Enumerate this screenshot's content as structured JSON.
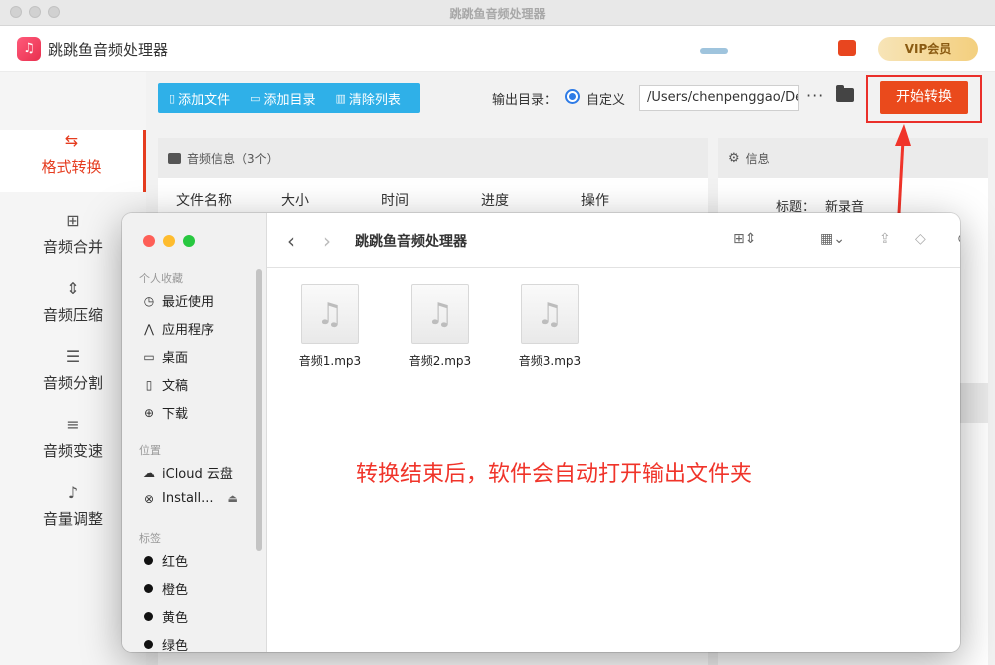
{
  "window": {
    "title": "跳跳鱼音频处理器"
  },
  "app": {
    "name": "跳跳鱼音频处理器",
    "logo_glyph": "♫",
    "promo_text": "VIP会员"
  },
  "sidebar": {
    "items": [
      {
        "label": "格式转换",
        "icon": "⇆"
      },
      {
        "label": "音频合并",
        "icon": "⊞"
      },
      {
        "label": "音频压缩",
        "icon": "⇕"
      },
      {
        "label": "音频分割",
        "icon": "☰"
      },
      {
        "label": "音频变速",
        "icon": "≡"
      },
      {
        "label": "音量调整",
        "icon": "♪"
      }
    ],
    "active_index": 0
  },
  "toolbar": {
    "add_file": "添加文件",
    "add_folder": "添加目录",
    "clear_list": "清除列表",
    "output_label": "输出目录：",
    "radio_label": "自定义",
    "output_path": "/Users/chenpenggao/Desktop",
    "more": "···",
    "start": "开始转换"
  },
  "audio_panel": {
    "title": "音频信息（3个）",
    "columns": [
      "文件名称",
      "大小",
      "时间",
      "进度",
      "操作"
    ]
  },
  "info_panel": {
    "title": "信息",
    "title_label": "标题：",
    "title_value": "新录音"
  },
  "annotation": "转换结束后，软件会自动打开输出文件夹",
  "finder": {
    "title": "跳跳鱼音频处理器",
    "favorites_label": "个人收藏",
    "favorites": [
      {
        "label": "最近使用",
        "icon": "◷"
      },
      {
        "label": "应用程序",
        "icon": "⋀"
      },
      {
        "label": "桌面",
        "icon": "▭"
      },
      {
        "label": "文稿",
        "icon": "▯"
      },
      {
        "label": "下载",
        "icon": "⊕"
      }
    ],
    "locations_label": "位置",
    "locations": [
      {
        "label": "iCloud 云盘",
        "icon": "☁"
      },
      {
        "label": "Install...",
        "icon": "⊗"
      }
    ],
    "tags_label": "标签",
    "tags": [
      {
        "label": "红色"
      },
      {
        "label": "橙色"
      },
      {
        "label": "黄色"
      },
      {
        "label": "绿色"
      }
    ],
    "files": [
      {
        "name": "音频1.mp3"
      },
      {
        "name": "音频2.mp3"
      },
      {
        "name": "音频3.mp3"
      }
    ]
  },
  "colors": {
    "accent": "#ea4a1c",
    "toolbar_blue": "#2fb0e8",
    "annotation_red": "#f0342a"
  }
}
